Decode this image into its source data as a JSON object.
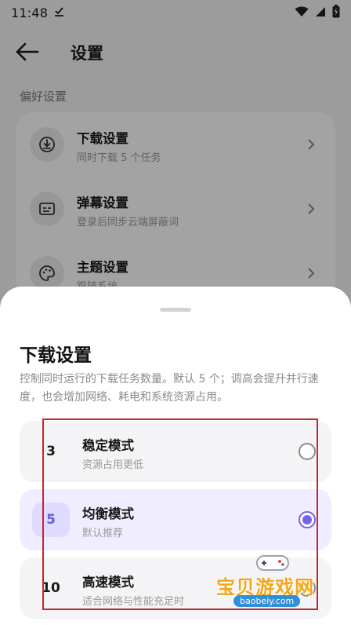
{
  "status_bar": {
    "time": "11:48",
    "icons": [
      "download-done-icon",
      "wifi-icon",
      "signal-icon",
      "battery-icon"
    ]
  },
  "header": {
    "title": "设置"
  },
  "settings": {
    "section_label": "偏好设置",
    "items": [
      {
        "title": "下载设置",
        "subtitle": "同时下载 5 个任务",
        "icon": "download-icon"
      },
      {
        "title": "弹幕设置",
        "subtitle": "登录后同步云端屏蔽词",
        "icon": "subtitles-icon"
      },
      {
        "title": "主题设置",
        "subtitle": "跟随系统",
        "icon": "palette-icon"
      }
    ]
  },
  "sheet": {
    "title": "下载设置",
    "description": "控制同时运行的下载任务数量。默认 5 个；调高会提升并行速度，也会增加网络、耗电和系统资源占用。",
    "options": [
      {
        "number": "3",
        "title": "稳定模式",
        "subtitle": "资源占用更低",
        "selected": false
      },
      {
        "number": "5",
        "title": "均衡模式",
        "subtitle": "默认推荐",
        "selected": true
      },
      {
        "number": "10",
        "title": "高速模式",
        "subtitle": "适合网络与性能充足时",
        "selected": false
      }
    ]
  },
  "watermark": {
    "text": "宝贝游戏网",
    "url": "baobeiy.com"
  },
  "colors": {
    "accent": "#7565e6",
    "selected_bg": "#efedff",
    "annotation_box": "#c9242c"
  }
}
